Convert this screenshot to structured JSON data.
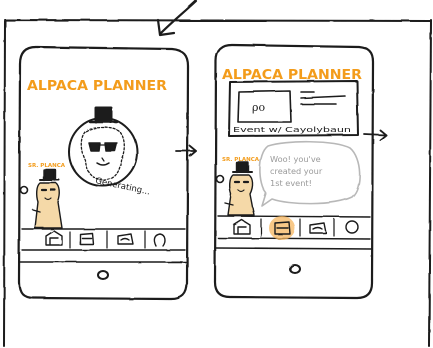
{
  "screen1": {
    "title": "ALPACA PLANNER",
    "status_text": "Generating...",
    "mascot_label": "SR. PLANCA"
  },
  "screen2": {
    "title": "ALPACA PLANNER",
    "card_logo": "ρο",
    "card_caption": "Event w/ Cayolybaun",
    "mascot_label": "SR. PLANCA",
    "speech_text": "Woo! you've created your 1st event!"
  },
  "colors": {
    "ink": "#1a1a1a",
    "title_orange": "#f39c1b",
    "active_tab": "#f6b55f",
    "speech_gray": "#b8b8b8",
    "alpaca_fill": "#f5d9a8"
  }
}
